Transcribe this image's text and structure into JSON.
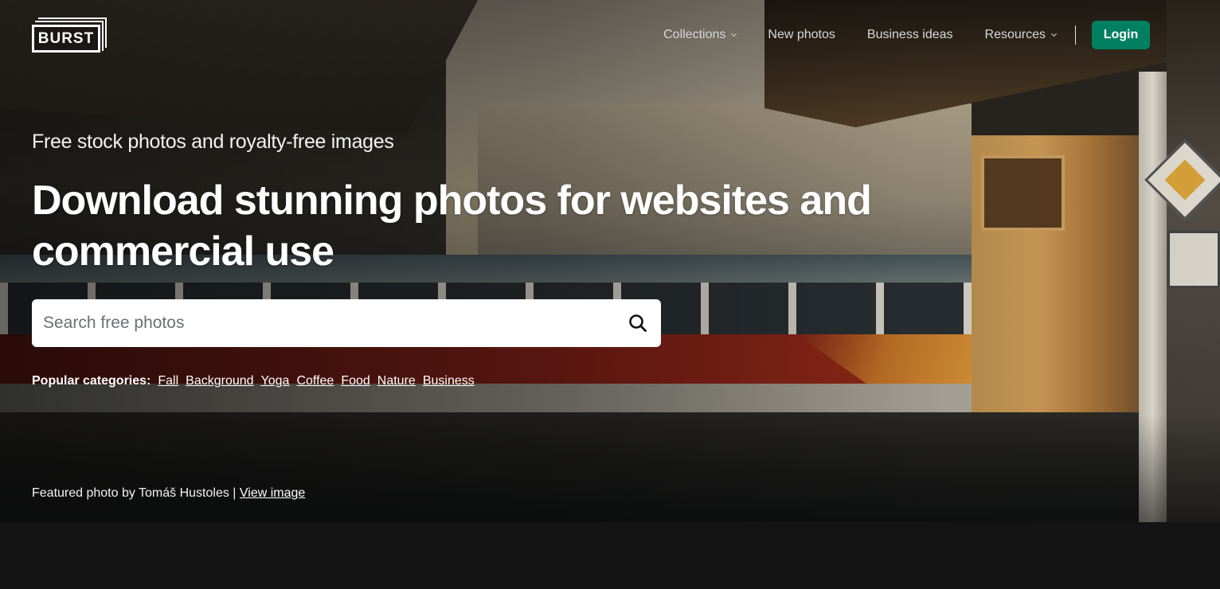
{
  "header": {
    "logo_text": "BURST",
    "nav": [
      {
        "label": "Collections",
        "has_dropdown": true
      },
      {
        "label": "New photos",
        "has_dropdown": false
      },
      {
        "label": "Business ideas",
        "has_dropdown": false
      },
      {
        "label": "Resources",
        "has_dropdown": true
      }
    ],
    "login_label": "Login"
  },
  "hero": {
    "subtitle": "Free stock photos and royalty-free images",
    "title": "Download stunning photos for websites and commercial use",
    "search": {
      "placeholder": "Search free photos",
      "value": "",
      "icon": "search-icon"
    },
    "popular_label": "Popular categories:",
    "categories": [
      "Fall",
      "Background",
      "Yoga",
      "Coffee",
      "Food",
      "Nature",
      "Business"
    ],
    "credit_prefix": "Featured photo by Tomáš Hustoles |",
    "credit_link": "View image"
  },
  "colors": {
    "accent": "#008060",
    "page_background": "#141414",
    "text": "#ffffff"
  }
}
